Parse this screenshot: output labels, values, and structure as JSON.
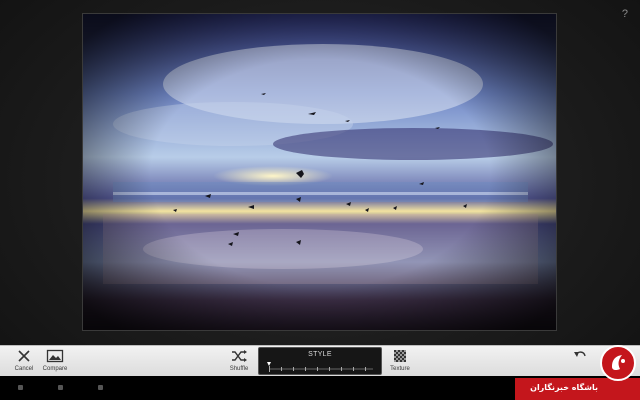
{
  "header": {
    "help_label": "?"
  },
  "photo": {
    "description_icon": "landscape-photo"
  },
  "toolbar": {
    "cancel_label": "Cancel",
    "compare_label": "Compare",
    "shuffle_label": "Shuffle",
    "texture_label": "Texture",
    "style_label": "STYLE"
  },
  "watermark": {
    "text": "باشگاه خبرنگاران"
  },
  "colors": {
    "brand": "#c4161c",
    "toolbar_bg": "#e6e6e6",
    "background": "#1c1c1c"
  }
}
